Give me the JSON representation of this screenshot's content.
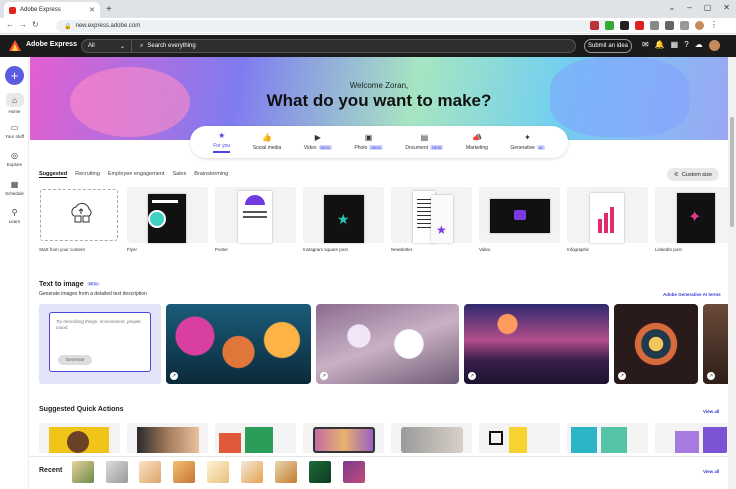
{
  "browser": {
    "tab_title": "Adobe Express",
    "url": "new.express.adobe.com"
  },
  "appbar": {
    "brand": "Adobe Express",
    "search_scope": "All",
    "search_placeholder": "Search everything",
    "submit_idea": "Submit an idea"
  },
  "rail": {
    "items": [
      {
        "label": "Home",
        "icon": "home-icon"
      },
      {
        "label": "Your stuff",
        "icon": "folder-icon"
      },
      {
        "label": "Explore",
        "icon": "compass-icon"
      },
      {
        "label": "Schedule",
        "icon": "calendar-icon"
      },
      {
        "label": "Learn",
        "icon": "lightbulb-icon"
      }
    ]
  },
  "hero": {
    "welcome": "Welcome Zoran,",
    "headline": "What do you want to make?"
  },
  "categories": [
    {
      "label": "For you",
      "badge": ""
    },
    {
      "label": "Social media",
      "badge": ""
    },
    {
      "label": "Video",
      "badge": "NEW"
    },
    {
      "label": "Photo",
      "badge": "NEW"
    },
    {
      "label": "Document",
      "badge": "NEW"
    },
    {
      "label": "Marketing",
      "badge": ""
    },
    {
      "label": "Generative",
      "badge": "AI"
    }
  ],
  "subtabs": [
    "Suggested",
    "Recruiting",
    "Employee engagement",
    "Sales",
    "Brainstorming"
  ],
  "custom_size": "Custom size",
  "templates": [
    "Start from your content",
    "Flyer",
    "Poster",
    "Instagram square post",
    "Newsletter",
    "Video",
    "Infographic",
    "LinkedIn post"
  ],
  "text_to_image": {
    "title": "Text to image",
    "badge": "BETA",
    "subtitle": "Generate images from a detailed text description",
    "terms_link": "Adobe Generative AI terms",
    "prompt_placeholder": "Try describing things, environment, people, mood.",
    "generate_button": "Generate"
  },
  "quick_actions": {
    "title": "Suggested Quick Actions",
    "view_all": "View all"
  },
  "recent": {
    "title": "Recent",
    "view_all": "View all"
  },
  "colors": {
    "accent": "#4b46e0",
    "appbar": "#1b1b1b"
  }
}
